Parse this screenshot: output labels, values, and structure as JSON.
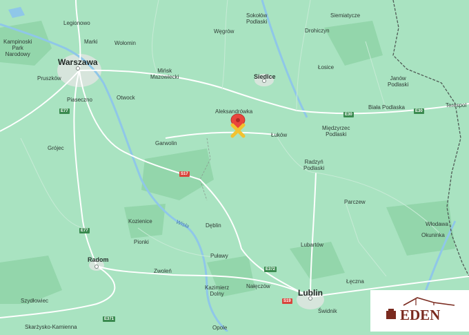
{
  "cities": {
    "warszawa": "Warszawa",
    "siedlce": "Siedlce",
    "lublin": "Lublin",
    "radom": "Radom",
    "legionowo": "Legionowo",
    "kampinoski": "Kampinoski\nPark\nNarodowy",
    "marki": "Marki",
    "wolomin": "Wołomin",
    "pruszkow": "Pruszków",
    "piaseczno": "Piaseczno",
    "otwock": "Otwock",
    "minsk": "Mińsk\nMazowiecki",
    "wegrow": "Węgrów",
    "sokolow": "Sokołów\nPodlaski",
    "siemiatycze": "Siemiatycze",
    "drohiczyn": "Drohiczyn",
    "losice": "Łosice",
    "janow": "Janów\nPodlaski",
    "biala": "Biała Podlaska",
    "terespol": "Terespol",
    "aleksandrowka": "Aleksandrówka",
    "lukow": "Łuków",
    "miedzyrzec": "Międzyrzec\nPodlaski",
    "garwolin": "Garwolin",
    "grojec": "Grójec",
    "radzyn": "Radzyń\nPodlaski",
    "parczew": "Parczew",
    "kozienice": "Kozienice",
    "deblin": "Dęblin",
    "wlodawa": "Włodawa",
    "okuninka": "Okuninka",
    "pionki": "Pionki",
    "lubartow": "Lubartów",
    "pulawy": "Puławy",
    "zwolen": "Zwoleń",
    "leczna": "Łęczna",
    "kazimierz": "Kazimierz\nDolny",
    "naleczow": "Nałęczów",
    "szydlowiec": "Szydłowiec",
    "swidnik": "Świdnik",
    "skarzysko": "Skarżysko-Kamienna",
    "opole": "Opole"
  },
  "roads": {
    "e77a": "E77",
    "e77b": "E77",
    "e30a": "E30",
    "e30b": "E30",
    "s17": "S17",
    "e372": "E372",
    "s19": "S19",
    "e371": "E371"
  },
  "river": "Wisła",
  "logo": {
    "text": "EDEN"
  },
  "colors": {
    "land": "#a9e3c1",
    "road": "#ffffff",
    "pin": "#e9453d",
    "marker": "#f2c230",
    "logo": "#7a2a1f"
  }
}
